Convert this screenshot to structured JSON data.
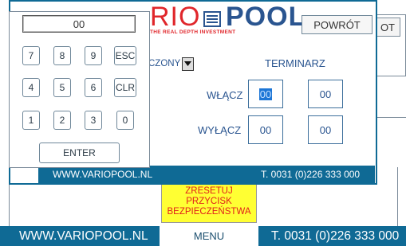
{
  "background": {
    "right_button_fragment": "OT",
    "reset_button": [
      "ZRESETUJ",
      "PRZYCISK",
      "BEZPIECZEŃSTWA"
    ],
    "bottom_bar": {
      "website": "WWW.VARIOPOOL.NL",
      "menu_label": "MENU",
      "phone": "T. 0031 (0)226 333 000"
    }
  },
  "scheduler": {
    "logo_rio": "RIO",
    "logo_tagline": "THE REAL DEPTH INVESTMENT",
    "logo_pool": "POOL",
    "back_button": "POWRÓT",
    "mode_value": "CZONY",
    "title": "TERMINARZ",
    "on_label": "WŁĄCZ",
    "off_label": "WYŁĄCZ",
    "on_hour": "00",
    "on_minute": "00",
    "off_hour": "00",
    "off_minute": "00",
    "footer": {
      "website": "WWW.VARIOPOOL.NL",
      "phone": "T. 0031 (0)226 333 000"
    }
  },
  "keypad": {
    "display": "00",
    "keys": {
      "k7": "7",
      "k8": "8",
      "k9": "9",
      "esc": "ESC",
      "k4": "4",
      "k5": "5",
      "k6": "6",
      "clr": "CLR",
      "k1": "1",
      "k2": "2",
      "k3": "3",
      "k0": "0",
      "enter": "ENTER"
    }
  },
  "colors": {
    "brand_blue": "#0f6a95",
    "logo_red": "#e0262b",
    "text_blue": "#2a5590",
    "reset_yellow": "#ffff33"
  }
}
